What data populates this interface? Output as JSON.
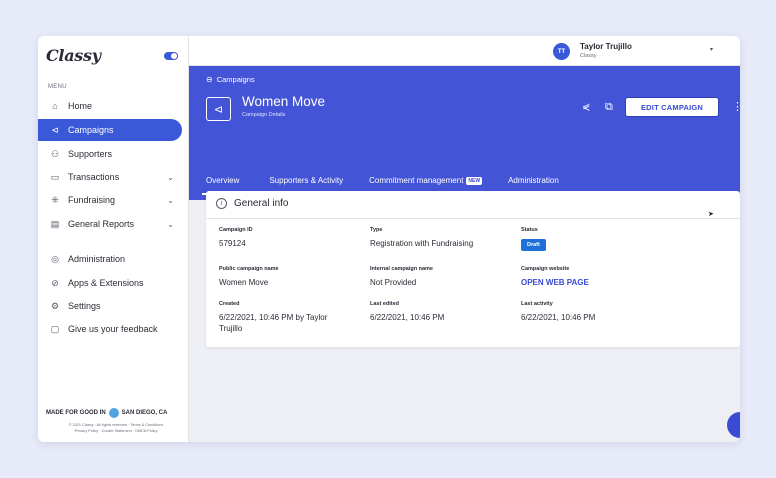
{
  "sidebar": {
    "logo": "Classy",
    "menu_label": "MENU",
    "items": [
      {
        "label": "Home",
        "icon": "⌂"
      },
      {
        "label": "Campaigns",
        "icon": "⊲"
      },
      {
        "label": "Supporters",
        "icon": "⚇"
      },
      {
        "label": "Transactions",
        "icon": "▭"
      },
      {
        "label": "Fundraising",
        "icon": "⁜"
      },
      {
        "label": "General Reports",
        "icon": "▤"
      },
      {
        "label": "Administration",
        "icon": "◎"
      },
      {
        "label": "Apps & Extensions",
        "icon": "⊘"
      },
      {
        "label": "Settings",
        "icon": "⚙"
      },
      {
        "label": "Give us your feedback",
        "icon": "▢"
      }
    ],
    "chevron": "⌄",
    "made_for": "MADE FOR GOOD IN",
    "city": "SAN DIEGO, CA",
    "legal_line1": "© 2021 Classy · All rights reserved · Terms & Conditions",
    "legal_line2": "Privacy Policy · Cookie Statement · DMCA Policy"
  },
  "user": {
    "initials": "TT",
    "name": "Taylor Trujillo",
    "org": "Classy",
    "caret": "▾"
  },
  "header": {
    "breadcrumb": "Campaigns",
    "title": "Women Move",
    "subtitle": "Campaign Details",
    "edit_label": "EDIT CAMPAIGN",
    "tabs": [
      {
        "label": "Overview"
      },
      {
        "label": "Supporters & Activity"
      },
      {
        "label": "Commitment management"
      },
      {
        "label": "Administration"
      }
    ],
    "new_badge": "NEW"
  },
  "general_info": {
    "heading": "General info",
    "fields": {
      "campaign_id": {
        "label": "Campaign ID",
        "value": "579124"
      },
      "type": {
        "label": "Type",
        "value": "Registration with Fundraising"
      },
      "status": {
        "label": "Status",
        "value": "Draft"
      },
      "public_name": {
        "label": "Public campaign name",
        "value": "Women Move"
      },
      "internal_name": {
        "label": "Internal campaign name",
        "value": "Not Provided"
      },
      "website": {
        "label": "Campaign website",
        "value": "OPEN WEB PAGE"
      },
      "created": {
        "label": "Created",
        "value": "6/22/2021, 10:46 PM by Taylor Trujillo"
      },
      "last_edited": {
        "label": "Last edited",
        "value": "6/22/2021, 10:46 PM"
      },
      "last_activity": {
        "label": "Last activity",
        "value": "6/22/2021, 10:46 PM"
      }
    }
  },
  "colors": {
    "accent": "#4454d6",
    "active_nav": "#3a59d8",
    "status_badge": "#2070d8"
  }
}
